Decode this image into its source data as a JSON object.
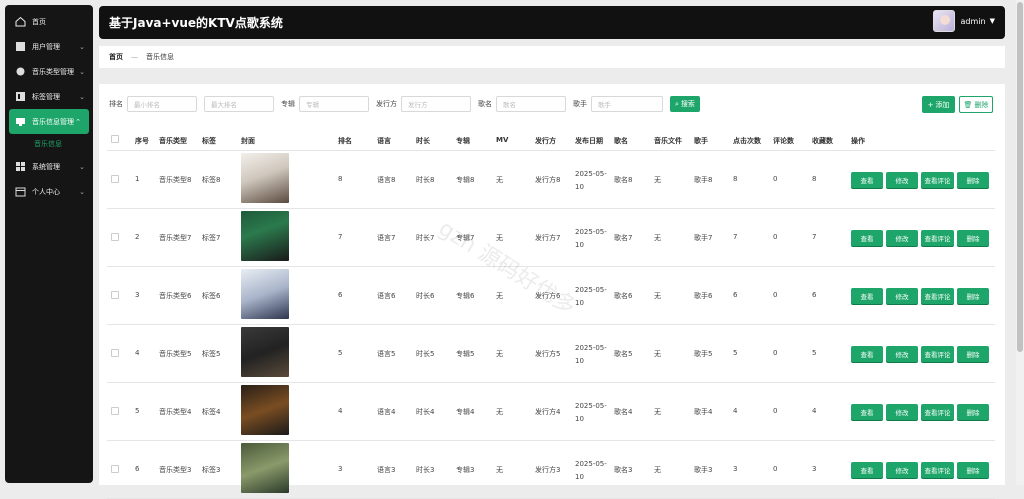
{
  "sidebar": {
    "items": [
      {
        "label": "首页",
        "icon": "home-icon"
      },
      {
        "label": "用户管理",
        "icon": "user-icon",
        "chevron": "⌄"
      },
      {
        "label": "音乐类型管理",
        "icon": "layers-icon",
        "chevron": "⌄"
      },
      {
        "label": "标签管理",
        "icon": "tag-icon",
        "chevron": "⌄"
      },
      {
        "label": "音乐信息管理",
        "icon": "monitor-icon",
        "chevron": "⌃"
      },
      {
        "label": "音乐信息",
        "sub": true
      },
      {
        "label": "系统管理",
        "icon": "grid-icon",
        "chevron": "⌄"
      },
      {
        "label": "个人中心",
        "icon": "calendar-icon",
        "chevron": "⌄"
      }
    ]
  },
  "header": {
    "title": "基于Java+vue的KTV点歌系统",
    "user": "admin"
  },
  "breadcrumb": {
    "home": "首页",
    "sep": "—",
    "current": "音乐信息"
  },
  "filters": {
    "rank_label": "排名",
    "rank_min_placeholder": "最小排名",
    "rank_max_placeholder": "最大排名",
    "album_label": "专辑",
    "album_placeholder": "专辑",
    "publisher_label": "发行方",
    "publisher_placeholder": "发行方",
    "song_label": "歌名",
    "song_placeholder": "歌名",
    "singer_label": "歌手",
    "singer_placeholder": "歌手",
    "search_button": "搜索"
  },
  "toolbar": {
    "add_label": "添加",
    "delete_label": "删除"
  },
  "table": {
    "headers": [
      "序号",
      "音乐类型",
      "标签",
      "封面",
      "排名",
      "语言",
      "时长",
      "专辑",
      "MV",
      "发行方",
      "发布日期",
      "歌名",
      "音乐文件",
      "歌手",
      "点击次数",
      "评论数",
      "收藏数",
      "操作"
    ],
    "actions": [
      "查看",
      "修改",
      "查看评论",
      "删除"
    ],
    "rows": [
      {
        "no": "1",
        "type": "音乐类型8",
        "tag": "标签8",
        "rank": "8",
        "lang": "语言8",
        "dur": "时长8",
        "album": "专辑8",
        "mv": "无",
        "pub": "发行方8",
        "date": "2025-05-10",
        "song": "歌名8",
        "file": "无",
        "singer": "歌手8",
        "clicks": "8",
        "comments": "0",
        "favs": "8"
      },
      {
        "no": "2",
        "type": "音乐类型7",
        "tag": "标签7",
        "rank": "7",
        "lang": "语言7",
        "dur": "时长7",
        "album": "专辑7",
        "mv": "无",
        "pub": "发行方7",
        "date": "2025-05-10",
        "song": "歌名7",
        "file": "无",
        "singer": "歌手7",
        "clicks": "7",
        "comments": "0",
        "favs": "7"
      },
      {
        "no": "3",
        "type": "音乐类型6",
        "tag": "标签6",
        "rank": "6",
        "lang": "语言6",
        "dur": "时长6",
        "album": "专辑6",
        "mv": "无",
        "pub": "发行方6",
        "date": "2025-05-10",
        "song": "歌名6",
        "file": "无",
        "singer": "歌手6",
        "clicks": "6",
        "comments": "0",
        "favs": "6"
      },
      {
        "no": "4",
        "type": "音乐类型5",
        "tag": "标签5",
        "rank": "5",
        "lang": "语言5",
        "dur": "时长5",
        "album": "专辑5",
        "mv": "无",
        "pub": "发行方5",
        "date": "2025-05-10",
        "song": "歌名5",
        "file": "无",
        "singer": "歌手5",
        "clicks": "5",
        "comments": "0",
        "favs": "5"
      },
      {
        "no": "5",
        "type": "音乐类型4",
        "tag": "标签4",
        "rank": "4",
        "lang": "语言4",
        "dur": "时长4",
        "album": "专辑4",
        "mv": "无",
        "pub": "发行方4",
        "date": "2025-05-10",
        "song": "歌名4",
        "file": "无",
        "singer": "歌手4",
        "clicks": "4",
        "comments": "0",
        "favs": "4"
      },
      {
        "no": "6",
        "type": "音乐类型3",
        "tag": "标签3",
        "rank": "3",
        "lang": "语言3",
        "dur": "时长3",
        "album": "专辑3",
        "mv": "无",
        "pub": "发行方3",
        "date": "2025-05-10",
        "song": "歌名3",
        "file": "无",
        "singer": "歌手3",
        "clicks": "3",
        "comments": "0",
        "favs": "3"
      }
    ]
  },
  "watermark": "gzh 源码好优多",
  "colors": {
    "accent": "#1ea66a",
    "sidebar_bg": "#151515",
    "header_bg": "#111111"
  }
}
